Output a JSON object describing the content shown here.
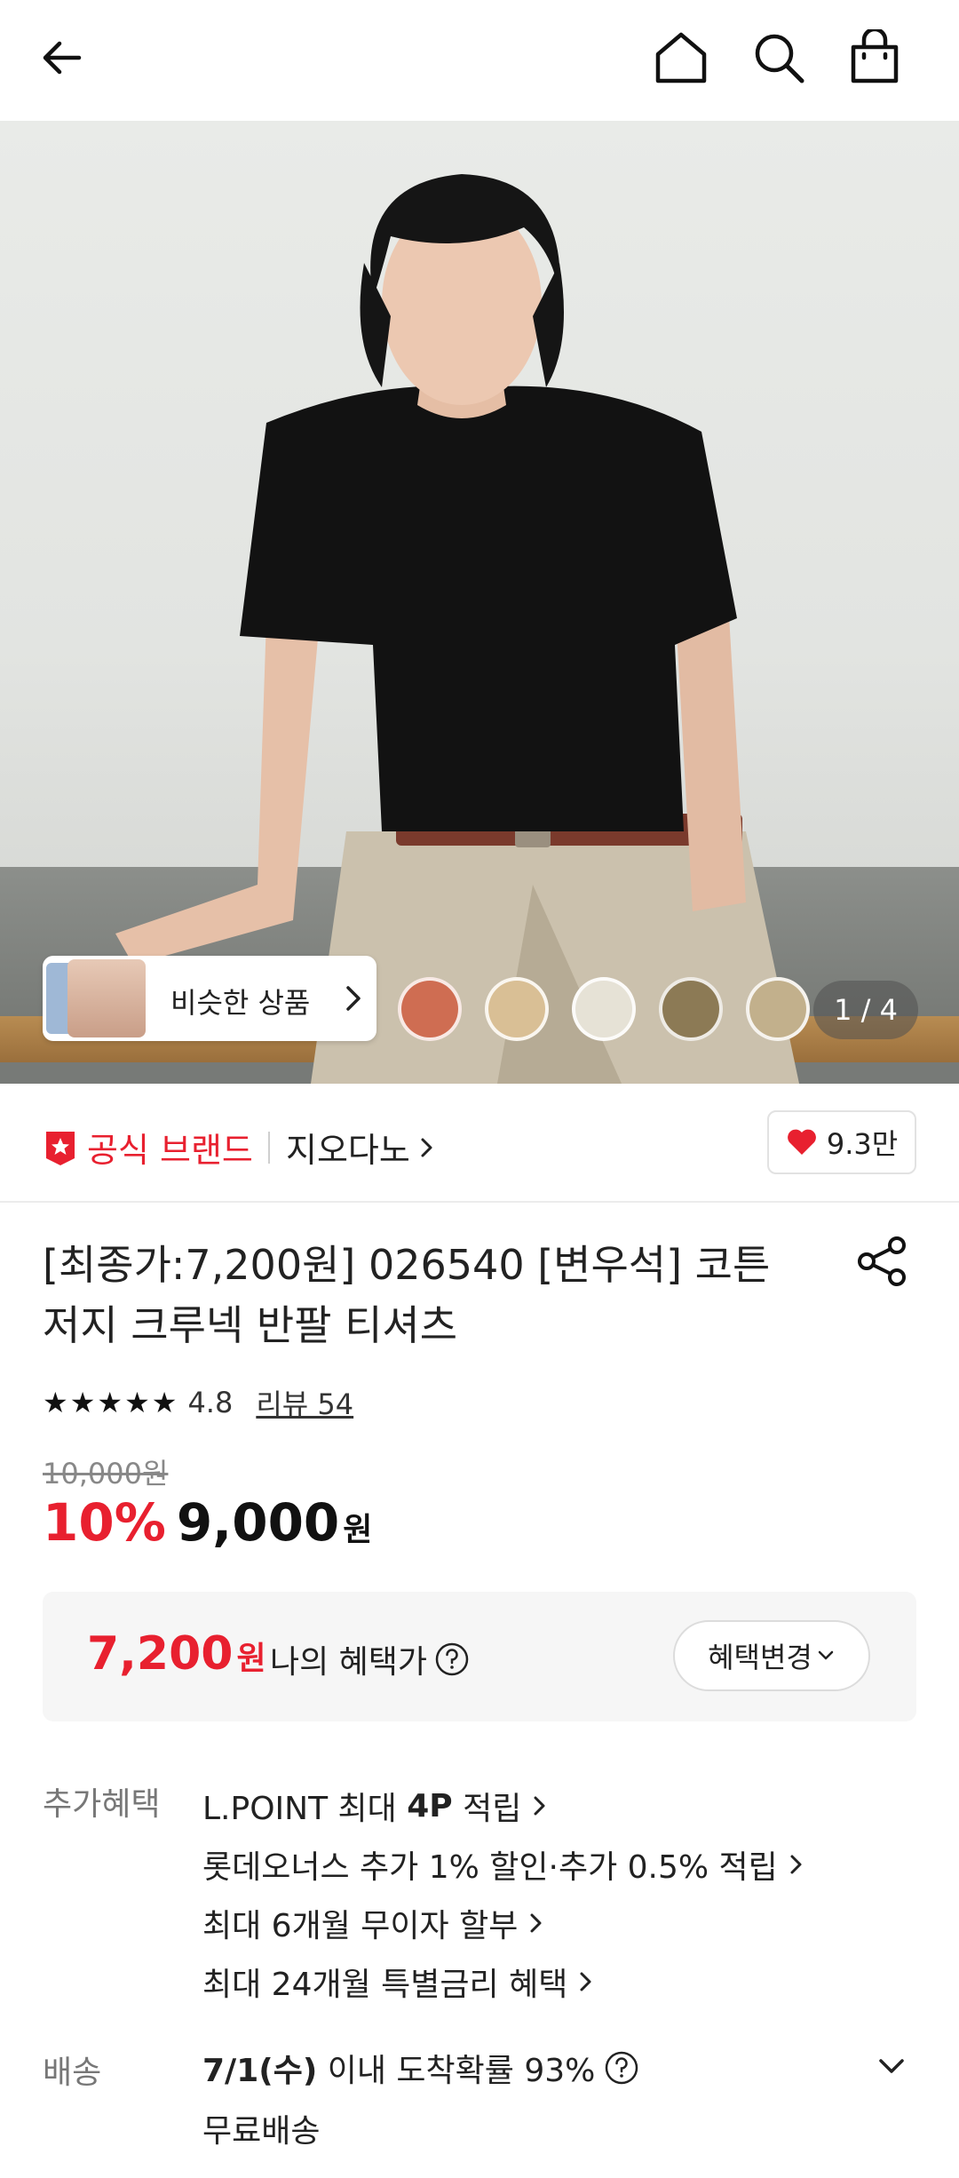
{
  "header": {
    "icons": [
      "back-arrow-icon",
      "home-icon",
      "search-icon",
      "shopping-bag-icon"
    ]
  },
  "hero": {
    "similar_label": "비슷한 상품",
    "swatch_colors": [
      "#cf6d52",
      "#d9bf95",
      "#e6e2d6",
      "#8c7a55",
      "#c2b08c"
    ],
    "page_indicator": "1 / 4"
  },
  "brand": {
    "official_label": "공식 브랜드",
    "name": "지오다노",
    "likes": "9.3만"
  },
  "product": {
    "title": "[최종가:7,200원] 026540 [변우석] 코튼 저지 크루넥 반팔 티셔츠",
    "stars": "★★★★★",
    "rating": "4.8",
    "reviews": "리뷰 54",
    "original_price": "10,000원",
    "discount_rate": "10%",
    "price": "9,000",
    "currency": "원"
  },
  "benefit": {
    "price": "7,200",
    "currency": "원",
    "label": "나의 혜택가",
    "change_button": "혜택변경"
  },
  "extra": {
    "label": "추가혜택",
    "items": [
      {
        "prefix": "L.POINT 최대 ",
        "bold": "4P",
        "suffix": " 적립"
      },
      {
        "prefix": "롯데오너스 추가 1% 할인·추가 0.5% 적립",
        "bold": "",
        "suffix": ""
      },
      {
        "prefix": "최대 6개월 무이자 할부",
        "bold": "",
        "suffix": ""
      },
      {
        "prefix": "최대 24개월 특별금리 혜택",
        "bold": "",
        "suffix": ""
      }
    ]
  },
  "shipping": {
    "label": "배송",
    "date": "7/1(수)",
    "text": " 이내 도착확률 93%",
    "sub": "무료배송"
  },
  "colors": {
    "accent_red": "#e8202f"
  }
}
